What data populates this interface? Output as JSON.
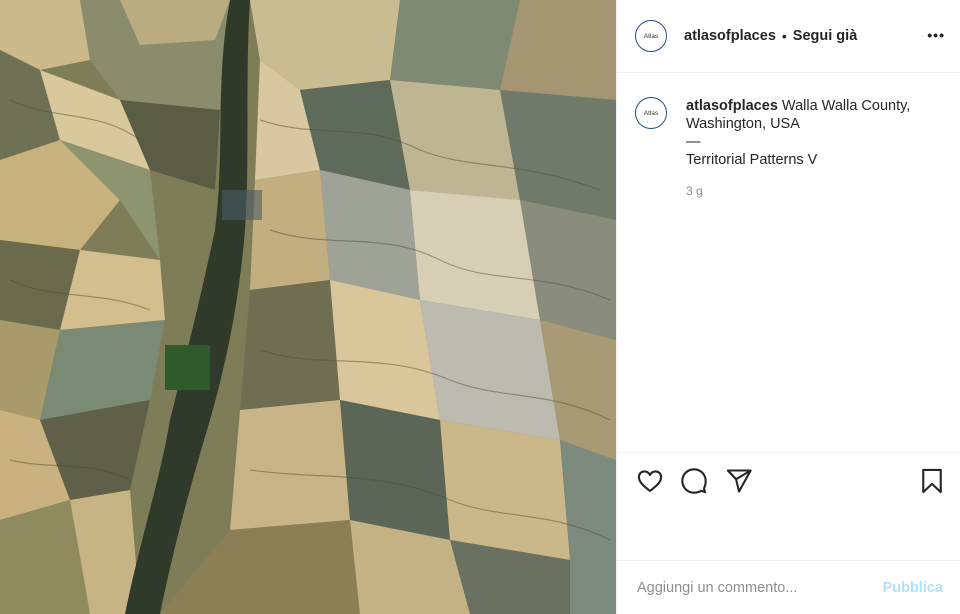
{
  "post": {
    "image_alt": "Aerial view of farmland and valleys"
  },
  "header": {
    "avatar_text": "Atlas",
    "username": "atlasofplaces",
    "separator": "•",
    "follow_status": "Segui già",
    "more_icon": "more-horizontal-icon"
  },
  "caption": {
    "avatar_text": "Atlas",
    "username": "atlasofplaces",
    "location": "Walla Walla County, Washington, USA",
    "dash": "—",
    "title": "Territorial Patterns V",
    "time_ago": "3 g"
  },
  "actions": {
    "like_icon": "heart-icon",
    "comment_icon": "comment-icon",
    "share_icon": "paper-plane-icon",
    "save_icon": "bookmark-icon"
  },
  "comment": {
    "placeholder": "Aggiungi un commento...",
    "publish_label": "Pubblica"
  },
  "colors": {
    "text": "#262626",
    "muted": "#8e8e8e",
    "divider": "#efefef",
    "publish_disabled": "#b2dffc"
  }
}
